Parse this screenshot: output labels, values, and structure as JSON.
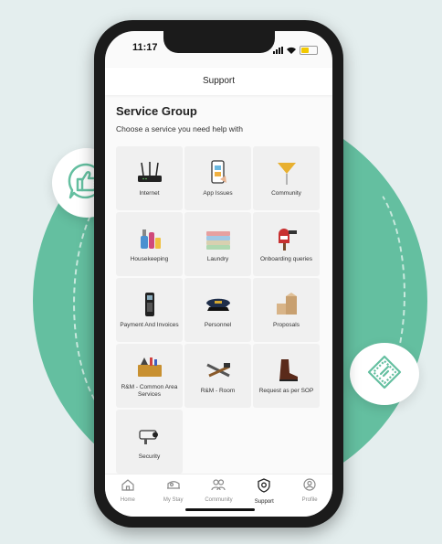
{
  "status": {
    "time": "11:17"
  },
  "header": {
    "title": "Support"
  },
  "section": {
    "title": "Service Group",
    "subtitle": "Choose a service you need help with"
  },
  "services": [
    {
      "label": "Internet",
      "icon": "router-icon"
    },
    {
      "label": "App Issues",
      "icon": "phone-app-icon"
    },
    {
      "label": "Community",
      "icon": "balloon-icon"
    },
    {
      "label": "Housekeeping",
      "icon": "cleaning-icon"
    },
    {
      "label": "Laundry",
      "icon": "laundry-icon"
    },
    {
      "label": "Onboarding queries",
      "icon": "mailbox-icon"
    },
    {
      "label": "Payment And Invoices",
      "icon": "card-machine-icon"
    },
    {
      "label": "Personnel",
      "icon": "cap-icon"
    },
    {
      "label": "Proposals",
      "icon": "boxes-icon"
    },
    {
      "label": "R&M - Common Area Services",
      "icon": "toolbox-icon"
    },
    {
      "label": "R&M - Room",
      "icon": "tools-icon"
    },
    {
      "label": "Request as per SOP",
      "icon": "boot-icon"
    },
    {
      "label": "Security",
      "icon": "cctv-icon"
    }
  ],
  "tabs": [
    {
      "label": "Home",
      "icon": "home-icon"
    },
    {
      "label": "My Stay",
      "icon": "bed-icon"
    },
    {
      "label": "Community",
      "icon": "people-icon"
    },
    {
      "label": "Support",
      "icon": "support-icon",
      "active": true
    },
    {
      "label": "Profile",
      "icon": "profile-icon"
    }
  ],
  "colors": {
    "accent": "#64bfa0",
    "background": "#e4eeee"
  }
}
